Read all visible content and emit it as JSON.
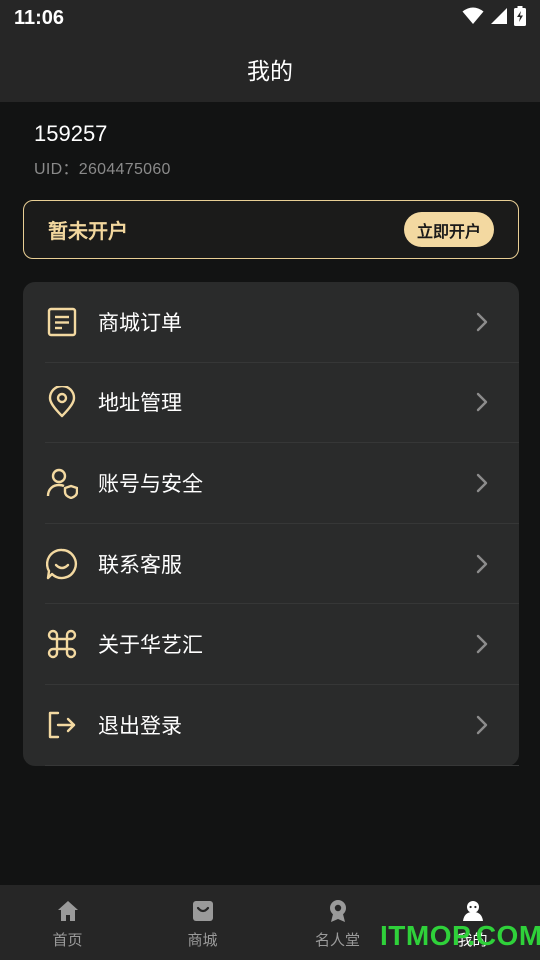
{
  "status_bar": {
    "time": "11:06"
  },
  "header": {
    "title": "我的"
  },
  "profile": {
    "username": "159257",
    "uid": "UID：2604475060"
  },
  "account": {
    "status": "暂未开户",
    "open_button": "立即开户"
  },
  "menu": {
    "items": [
      {
        "label": "商城订单",
        "icon": "order-list-icon"
      },
      {
        "label": "地址管理",
        "icon": "location-pin-icon"
      },
      {
        "label": "账号与安全",
        "icon": "user-shield-icon"
      },
      {
        "label": "联系客服",
        "icon": "chat-smile-icon"
      },
      {
        "label": "关于华艺汇",
        "icon": "command-icon"
      },
      {
        "label": "退出登录",
        "icon": "logout-icon"
      }
    ]
  },
  "bottom_nav": {
    "items": [
      {
        "label": "首页",
        "icon": "home-icon"
      },
      {
        "label": "商城",
        "icon": "shop-bag-icon"
      },
      {
        "label": "名人堂",
        "icon": "medal-icon"
      },
      {
        "label": "我的",
        "icon": "profile-icon",
        "active": true
      }
    ]
  },
  "watermark": "ITMOP.COM",
  "colors": {
    "accent": "#f3d9a1",
    "background": "#121313",
    "card": "#2a2b2b",
    "bar": "#262626",
    "watermark": "#2fd13a"
  }
}
